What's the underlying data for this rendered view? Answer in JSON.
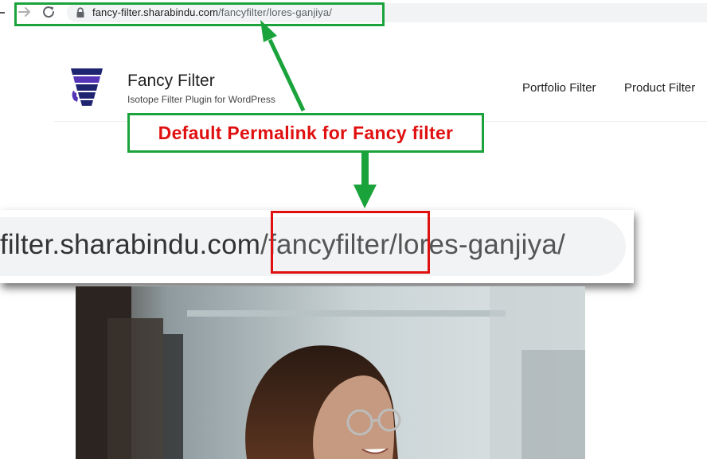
{
  "browser": {
    "address": {
      "host": "fancy-filter.sharabindu.com",
      "path": "/fancyfilter/lores-ganjiya/"
    },
    "icons": [
      "arrow-forward-icon",
      "reload-icon",
      "lock-icon"
    ]
  },
  "site": {
    "title": "Fancy Filter",
    "tagline": "Isotope Filter Plugin for WordPress",
    "nav": [
      "Portfolio Filter",
      "Product Filter"
    ]
  },
  "annotation": {
    "label": "Default Permalink for Fancy filter",
    "highlight_color": "#1aa33a",
    "emphasis_color": "#e01010"
  },
  "zoomed": {
    "host_part": "filter.sharabindu.com",
    "highlight": "/fancyfilter/",
    "rest": "lores-ganjiya/"
  },
  "colors": {
    "logo_navy": "#1f2470",
    "logo_violet": "#5534b8"
  }
}
